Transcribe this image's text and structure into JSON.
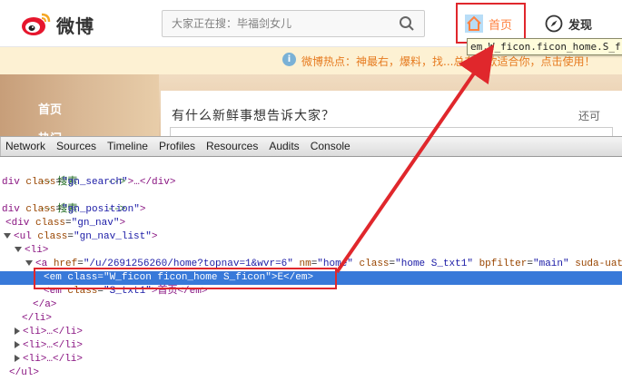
{
  "header": {
    "logo_text": "微博",
    "search_placeholder": "大家正在搜：毕福剑女儿",
    "nav_home_label": "首页",
    "nav_find_label": "发现"
  },
  "tooltip": {
    "text": "em.W_ficon.ficon_home.S_f"
  },
  "hot_bar": {
    "info_glyph": "i",
    "text": "微博热点：神最右，爆料，找...总有一款适合你，点击使用！"
  },
  "left_nav": {
    "home": "首页",
    "hot": "热门"
  },
  "publisher": {
    "prompt": "有什么新鲜事想告诉大家？",
    "more": "还可"
  },
  "devtools": {
    "tabs": [
      "Network",
      "Sources",
      "Timeline",
      "Profiles",
      "Resources",
      "Audits",
      "Console"
    ],
    "lines": {
      "l0": "-- 搜索     -->",
      "l1_pre": "div ",
      "l1_attr": "class",
      "l1_val": "\"gn_search\"",
      "l1_post": ">…</div>",
      "l2": "-- 搜索     -->",
      "l3_pre": "div ",
      "l3_attr": "class",
      "l3_val": "\"gn_position\"",
      "l3_post": ">",
      "l4_pre": "<div ",
      "l4_attr": "class",
      "l4_val": "\"gn_nav\"",
      "l4_post": ">",
      "l5_pre": "<ul ",
      "l5_attr": "class",
      "l5_val": "\"gn_nav_list\"",
      "l5_post": ">",
      "l6": "<li>",
      "l7_pre": "<a ",
      "l7_attr1": "href",
      "l7_val1": "\"/u/2691256260/home?topnav=1&wvr=6\"",
      "l7_attr2": "nm",
      "l7_val2": "\"home\"",
      "l7_attr3": "class",
      "l7_val3": "\"home S_txt1\"",
      "l7_attr4": "bpfilter",
      "l7_val4": "\"main\"",
      "l7_attr5": "suda-uat",
      "l8": "<em class=\"W_ficon ficon_home S_ficon\">E</em>",
      "l9_pre": "<em ",
      "l9_attr": "class",
      "l9_val": "\"S_txt1\"",
      "l9_mid": ">首页",
      "l9_post": "</em>",
      "l10": "</a>",
      "l11": "</li>",
      "l12": "<li>…</li>",
      "l13": "<li>…</li>",
      "l14": "<li>…</li>",
      "l15": "</ul>"
    }
  },
  "colors": {
    "accent_orange": "#ff8140",
    "highlight_red": "#e0272c",
    "selection_blue": "#3879d9"
  }
}
